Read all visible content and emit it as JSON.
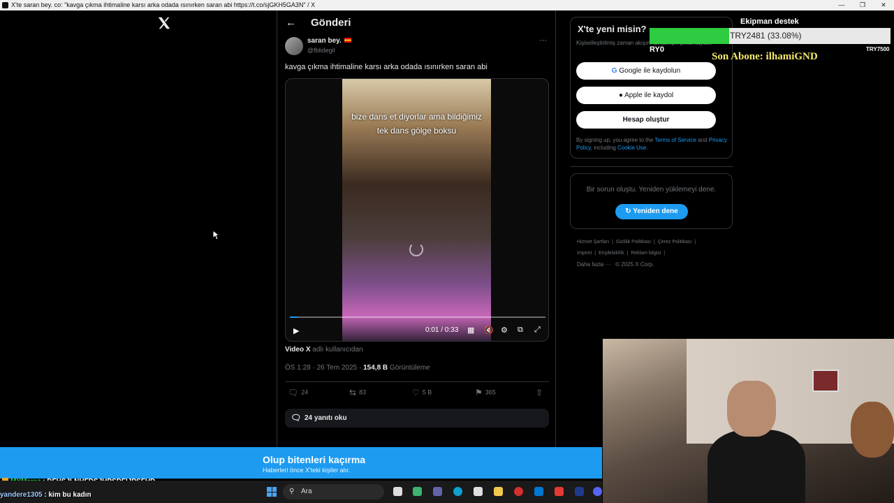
{
  "window": {
    "title": "X'te saran bey. co: \"kavga çıkma ihtimaline karsı arka odada ısınırken saran abi https://t.co/sjGKH5GA3N\" / X"
  },
  "header": {
    "back_icon": "arrow-left-icon",
    "title": "Gönderi"
  },
  "post": {
    "display_name": "saran bey.",
    "handle": "@fblidegil",
    "text": "kavga çıkma ihtimaline karsı arka odada ısınırken saran abi",
    "video": {
      "caption": "bize dans et diyorlar ama bildiğimiz tek dans gölge boksu",
      "time": "0:01 / 0:33",
      "progress": 0.03
    },
    "via_bold": "Video X",
    "via_rest": " adlı kullanıcıdan",
    "meta_time": "ÖS 1:28 · 26 Tem 2025 · ",
    "views": "154,8 B",
    "views_label": " Görüntüleme",
    "actions": {
      "replies": "24",
      "reposts": "83",
      "likes": "5 B",
      "bookmarks": "365"
    },
    "read_replies": "24 yanıtı oku"
  },
  "signup": {
    "title": "X'te yeni misin?",
    "subtitle": "Kişiselleştirilmiş zaman akışını almak için şimdi kaydol!",
    "google": "Google ile kaydolun",
    "apple": "Apple ile kaydol",
    "create": "Hesap oluştur",
    "terms_pre": "By signing up, you agree to the ",
    "terms_tos": "Terms of Service",
    "terms_and": " and ",
    "terms_pp": "Privacy Policy",
    "terms_inc": ", including ",
    "terms_cookie": "Cookie Use."
  },
  "error": {
    "text": "Bir sorun oluştu. Yeniden yüklemeyi dene.",
    "retry": "Yeniden dene"
  },
  "footer": {
    "row1": [
      "Hizmet Şartları",
      "Gizlilik Politikası",
      "Çerez Politikası"
    ],
    "row2": [
      "Imprint",
      "Erişilebilirlik",
      "Reklam bilgisi"
    ],
    "more": "Daha fazla ···",
    "copyright": "© 2025 X Corp."
  },
  "overlay": {
    "goal_label": "Ekipman destek",
    "goal_text": "TRY2481 (33.08%)",
    "goal_progress": 0.3308,
    "min": "RY0",
    "max": "TRY7500",
    "last_sub": "Son Abone: ilhamiGND"
  },
  "banner": {
    "title": "Olup bitenleri kaçırma",
    "subtitle": "Haberleri önce X'teki kişiler alır."
  },
  "chat": [
    {
      "user": "MYMaraz",
      "message": ": DFHSJLNHFDSJHPSDFIJPSFHD"
    },
    {
      "user": "yandere1305",
      "message": ": kim bu kadın"
    }
  ],
  "taskbar": {
    "search": "Ara"
  }
}
